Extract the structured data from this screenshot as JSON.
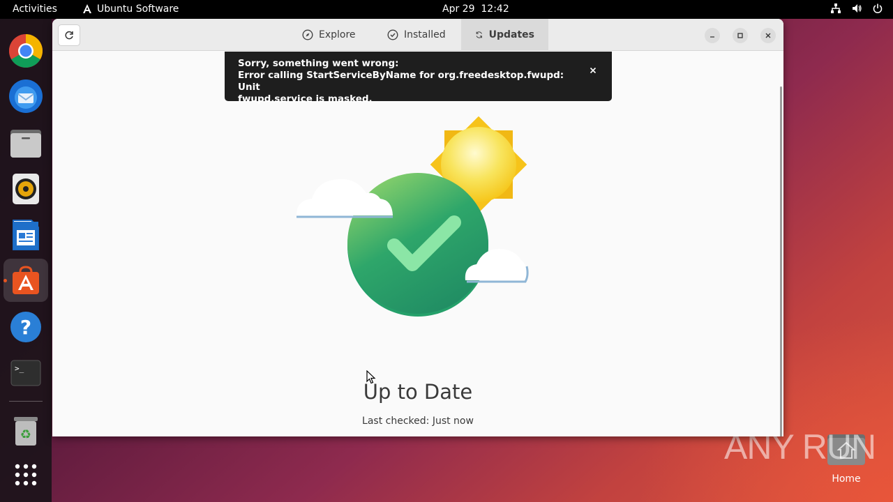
{
  "topbar": {
    "activities": "Activities",
    "app_name": "Ubuntu Software",
    "date": "Apr 29",
    "time": "12:42",
    "tray_icons": [
      "network-icon",
      "volume-icon",
      "power-icon"
    ]
  },
  "dock": {
    "items": [
      {
        "name": "Google Chrome",
        "icon": "chrome-icon"
      },
      {
        "name": "Thunderbird",
        "icon": "thunderbird-icon"
      },
      {
        "name": "Files",
        "icon": "files-icon"
      },
      {
        "name": "Rhythmbox",
        "icon": "rhythmbox-icon"
      },
      {
        "name": "LibreOffice Writer",
        "icon": "writer-icon"
      },
      {
        "name": "Ubuntu Software",
        "icon": "software-icon",
        "active": true
      },
      {
        "name": "Help",
        "icon": "help-icon"
      },
      {
        "name": "Terminal",
        "icon": "terminal-icon"
      },
      {
        "name": "Trash",
        "icon": "trash-icon"
      },
      {
        "name": "Show Applications",
        "icon": "app-grid-icon"
      }
    ]
  },
  "window": {
    "tabs": [
      {
        "label": "Explore",
        "icon": "compass-icon"
      },
      {
        "label": "Installed",
        "icon": "check-circle-icon"
      },
      {
        "label": "Updates",
        "icon": "sync-icon",
        "active": true
      }
    ],
    "notification": {
      "line1": "Sorry, something went wrong:",
      "line2": "Error calling StartServiceByName for org.freedesktop.fwupd: Unit",
      "line3": "fwupd.service is masked."
    },
    "status": {
      "title": "Up to Date",
      "subtitle": "Last checked: Just now"
    }
  },
  "desktop": {
    "home_label": "Home",
    "watermark": "ANY RUN"
  },
  "colors": {
    "accent": "#e95420",
    "toast_bg": "#1e1e1e",
    "check_green": "#26a269"
  }
}
